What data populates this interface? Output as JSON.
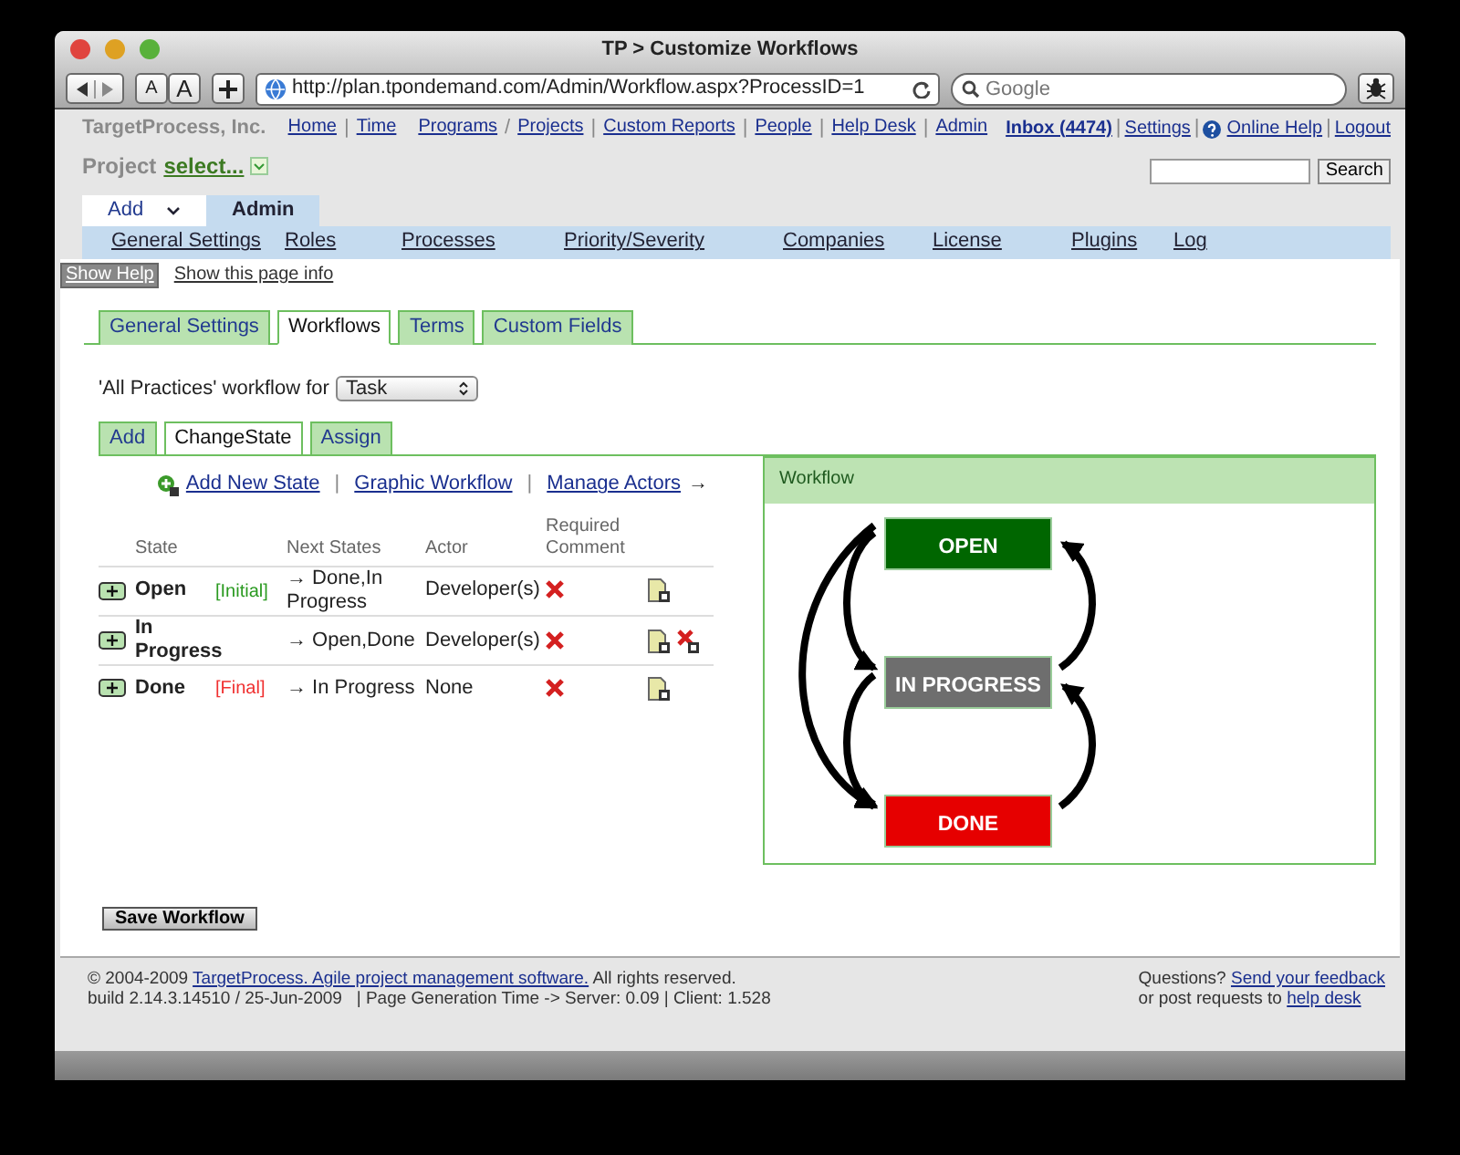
{
  "window": {
    "title": "TP > Customize Workflows"
  },
  "browser": {
    "text_size_buttons": [
      "A",
      "A"
    ],
    "url": "http://plan.tpondemand.com/Admin/Workflow.aspx?ProcessID=1",
    "search": {
      "placeholder": "Google"
    }
  },
  "header": {
    "company": "TargetProcess, Inc.",
    "project_label": "Project",
    "project_select": "select...",
    "links": [
      {
        "label": "Home"
      },
      {
        "label": "Time",
        "sep": "|"
      },
      {
        "label": "Programs"
      },
      {
        "label": "Projects",
        "sep": "/"
      },
      {
        "label": "Custom Reports",
        "sep": "|"
      },
      {
        "label": "People",
        "sep": "|"
      },
      {
        "label": "Help Desk",
        "sep": "|"
      },
      {
        "label": "Admin",
        "sep": "|"
      }
    ],
    "user_links": [
      {
        "label": "Inbox (4474)",
        "kind": "inbox"
      },
      {
        "label": "Settings",
        "kind": "link",
        "sep": "|"
      },
      {
        "label": "Online Help",
        "kind": "help",
        "sep": "|"
      },
      {
        "label": "Logout",
        "kind": "link",
        "sep": "|"
      }
    ],
    "search_button": "Search"
  },
  "top_tabs": [
    {
      "label": "Add",
      "kind": "dropdown",
      "selected": false
    },
    {
      "label": "Admin",
      "kind": "tab",
      "selected": true
    }
  ],
  "admin_nav": [
    "General Settings",
    "Roles",
    "Processes",
    "Priority/Severity",
    "Companies",
    "License",
    "Plugins",
    "Log"
  ],
  "help_bar": {
    "show_help": "Show Help",
    "page_info": "Show this page info"
  },
  "sub_tabs": [
    {
      "label": "General Settings",
      "selected": false
    },
    {
      "label": "Workflows",
      "selected": true
    },
    {
      "label": "Terms",
      "selected": false
    },
    {
      "label": "Custom Fields",
      "selected": false
    }
  ],
  "workflow_for": {
    "label": "'All Practices' workflow for",
    "value": "Task"
  },
  "inner_tabs": [
    {
      "label": "Add",
      "selected": false
    },
    {
      "label": "ChangeState",
      "selected": true
    },
    {
      "label": "Assign",
      "selected": false
    }
  ],
  "actions": {
    "links": [
      {
        "label": "Add New State"
      },
      {
        "label": "Graphic Workflow",
        "sep": "|"
      },
      {
        "label": "Manage Actors",
        "sep": "|"
      }
    ],
    "arrow": "→"
  },
  "table": {
    "columns": [
      "State",
      "Next States",
      "Actor",
      "Required Comment"
    ],
    "rows": [
      {
        "state": "Open",
        "tag": {
          "text": "[Initial]",
          "kind": "initial"
        },
        "next": "→ Done,In Progress",
        "actor": "Developer(s)",
        "required_comment": false,
        "deletable": false
      },
      {
        "state": "In Progress",
        "next": "→ Open,Done",
        "actor": "Developer(s)",
        "required_comment": false,
        "deletable": true
      },
      {
        "state": "Done",
        "tag": {
          "text": "[Final]",
          "kind": "final"
        },
        "next": "→ In Progress",
        "actor": "None",
        "required_comment": false,
        "deletable": false
      }
    ]
  },
  "diagram": {
    "title": "Workflow",
    "nodes": [
      {
        "label": "OPEN",
        "color": "#006600"
      },
      {
        "label": "IN PROGRESS",
        "color": "#6e6e6e"
      },
      {
        "label": "DONE",
        "color": "#e60000"
      }
    ]
  },
  "save_button": "Save Workflow",
  "footer": {
    "copyright_pre": "© 2004-2009",
    "copyright_link": "TargetProcess. Agile project management software.",
    "copyright_post": "All rights reserved.",
    "build": "build 2.14.3.14510 / 25-Jun-2009   | Page Generation Time -> Server: 0.09 | Client: 1.528",
    "questions": "Questions?",
    "feedback": "Send your feedback",
    "post": "or post requests to",
    "helpdesk": "help desk"
  }
}
